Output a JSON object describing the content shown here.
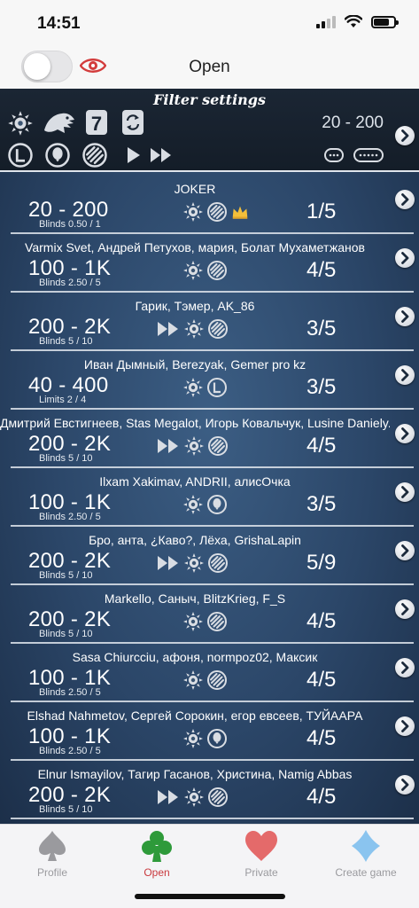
{
  "status": {
    "time": "14:51"
  },
  "header": {
    "title": "Open",
    "toggle_on": false
  },
  "filter": {
    "title": "Filter settings",
    "range": "20 - 200"
  },
  "rows": [
    {
      "names": "JOKER",
      "range": "20 - 200",
      "blinds": "Blinds 0.50 / 1",
      "seats": "1/5",
      "icons": [
        "sun-icon",
        "striped-ball-icon",
        "crown-icon"
      ]
    },
    {
      "names": "Varmix Svet, Андрей Петухов, мария, Болат Мухаметжанов",
      "range": "100 - 1K",
      "blinds": "Blinds 2.50 / 5",
      "seats": "4/5",
      "icons": [
        "sun-icon",
        "striped-ball-icon"
      ]
    },
    {
      "names": "Гарик, Тэмер, AK_86",
      "range": "200 - 2K",
      "blinds": "Blinds 5 / 10",
      "seats": "3/5",
      "icons": [
        "fast-forward-icon",
        "sun-icon",
        "striped-ball-icon"
      ]
    },
    {
      "names": "Иван Дымный, Berezyak, Gemer pro kz",
      "range": "40 - 400",
      "blinds": "Limits 2 / 4",
      "seats": "3/5",
      "icons": [
        "sun-icon",
        "limit-icon"
      ]
    },
    {
      "names": "Дмитрий Евстигнеев, Stas Megalot, Игорь Ковальчук, Lusine Daniely...",
      "range": "200 - 2K",
      "blinds": "Blinds 5 / 10",
      "seats": "4/5",
      "icons": [
        "fast-forward-icon",
        "sun-icon",
        "striped-ball-icon"
      ]
    },
    {
      "names": "Ilxam Xakimav, ANDRII, алисОчка",
      "range": "100 - 1K",
      "blinds": "Blinds 2.50 / 5",
      "seats": "3/5",
      "icons": [
        "sun-icon",
        "balloon-icon"
      ]
    },
    {
      "names": "Бро, анта, ¿Каво?, Лёха, GrishaLapin",
      "range": "200 - 2K",
      "blinds": "Blinds 5 / 10",
      "seats": "5/9",
      "icons": [
        "fast-forward-icon",
        "sun-icon",
        "striped-ball-icon"
      ]
    },
    {
      "names": "Markello, Саныч, BlitzKrieg, F_S",
      "range": "200 - 2K",
      "blinds": "Blinds 5 / 10",
      "seats": "4/5",
      "icons": [
        "sun-icon",
        "striped-ball-icon"
      ]
    },
    {
      "names": "Sasa Chiurcciu, афоня, normpoz02, Максик",
      "range": "100 - 1K",
      "blinds": "Blinds 2.50 / 5",
      "seats": "4/5",
      "icons": [
        "sun-icon",
        "striped-ball-icon"
      ]
    },
    {
      "names": "Elshad Nahmetov, Сергей Сорокин, егор евсеев, ТУЙААРА",
      "range": "100 - 1K",
      "blinds": "Blinds 2.50 / 5",
      "seats": "4/5",
      "icons": [
        "sun-icon",
        "balloon-icon"
      ]
    },
    {
      "names": "Elnur Ismayilov, Тагир Гасанов, Христина, Namig Abbas",
      "range": "200 - 2K",
      "blinds": "Blinds 5 / 10",
      "seats": "4/5",
      "icons": [
        "fast-forward-icon",
        "sun-icon",
        "striped-ball-icon"
      ]
    }
  ],
  "tabs": [
    {
      "label": "Profile",
      "icon": "spade-icon",
      "active": false
    },
    {
      "label": "Open",
      "icon": "club-icon",
      "active": true
    },
    {
      "label": "Private",
      "icon": "heart-icon",
      "active": false
    },
    {
      "label": "Create game",
      "icon": "diamond-icon",
      "active": false
    }
  ],
  "colors": {
    "accent": "#c9393e",
    "felt": "#2b4668",
    "club": "#2e9a3a",
    "heart": "#e46a6a",
    "diamond": "#8ac4ef",
    "spade": "#9a9a9e"
  }
}
